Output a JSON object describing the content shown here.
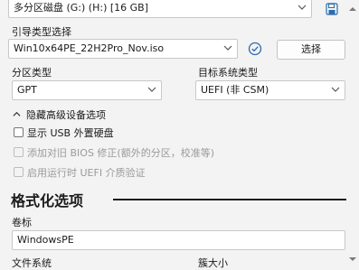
{
  "device": {
    "value": "多分区磁盘 (G:) (H:) [16 GB]"
  },
  "boot": {
    "label": "引导类型选择",
    "value": "Win10x64PE_22H2Pro_Nov.iso",
    "select_label": "选择"
  },
  "partition": {
    "label": "分区类型",
    "value": "GPT"
  },
  "target": {
    "label": "目标系统类型",
    "value": "UEFI (非 CSM)"
  },
  "advanced": {
    "toggle_label": "隐藏高级设备选项",
    "options": [
      {
        "label": "显示 USB 外置硬盘",
        "checked": false,
        "enabled": true
      },
      {
        "label": "添加对旧 BIOS 修正(额外的分区，校准等)",
        "checked": false,
        "enabled": false
      },
      {
        "label": "启用运行时 UEFI 介质验证",
        "checked": false,
        "enabled": false
      }
    ]
  },
  "format": {
    "section_title": "格式化选项",
    "volume_label": "卷标",
    "volume_value": "WindowsPE",
    "fs_label": "文件系统",
    "cluster_label": "簇大小"
  }
}
